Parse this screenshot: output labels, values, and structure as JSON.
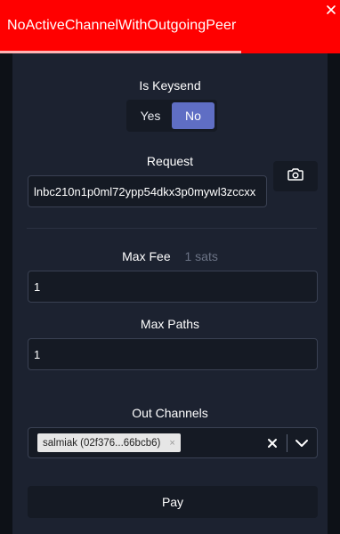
{
  "toast": {
    "message": "NoActiveChannelWithOutgoingPeer",
    "color": "#ff0000",
    "close_icon": "close-icon",
    "progress_fraction": 0.71
  },
  "keysend": {
    "label": "Is Keysend",
    "options": [
      "Yes",
      "No"
    ],
    "selected": "No",
    "accent": "#5f6ec4"
  },
  "request": {
    "label": "Request",
    "value": "lnbc210n1p0ml72ypp54dkx3p0mywl3zccxx",
    "scan_icon": "camera-icon"
  },
  "max_fee": {
    "label": "Max Fee",
    "unit_hint": "1 sats",
    "value": "1"
  },
  "max_paths": {
    "label": "Max Paths",
    "value": "1"
  },
  "out_channels": {
    "label": "Out Channels",
    "selected_chip": "salmiak (02f376...66bcb6)",
    "chip_remove": "×",
    "clear_icon": "close-icon",
    "dropdown_icon": "chevron-down-icon"
  },
  "pay": {
    "label": "Pay"
  }
}
